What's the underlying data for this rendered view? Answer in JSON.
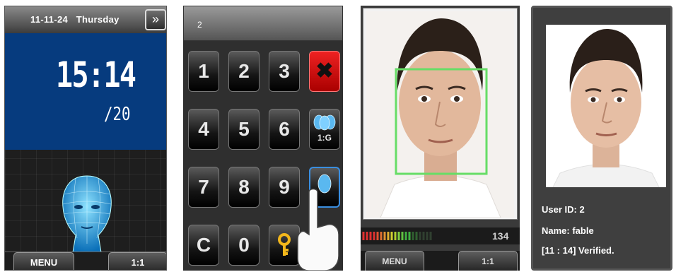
{
  "standby": {
    "date": "11-11-24",
    "weekday": "Thursday",
    "time": "15:14",
    "day_of_month": "/20",
    "menu_label": "MENU",
    "mode_label": "1:1",
    "icons": [
      "double-chevron-right-icon",
      "wireframe-head-icon"
    ]
  },
  "keypad": {
    "input_value": "2",
    "keys": [
      "1",
      "2",
      "3",
      "4",
      "5",
      "6",
      "7",
      "8",
      "9",
      "C",
      "0"
    ],
    "group_label": "1:G",
    "icons": [
      "delete-x-icon",
      "group-faces-icon",
      "single-face-icon",
      "key-icon",
      "pointing-hand-icon"
    ],
    "accent_color": "#cc1111"
  },
  "capture": {
    "quality_value": "134",
    "menu_label": "MENU",
    "mode_label": "1:1",
    "frame_color": "#66dd66"
  },
  "verified": {
    "user_id": "User ID: 2",
    "name": "Name: fable",
    "status": "[11 : 14] Verified."
  }
}
